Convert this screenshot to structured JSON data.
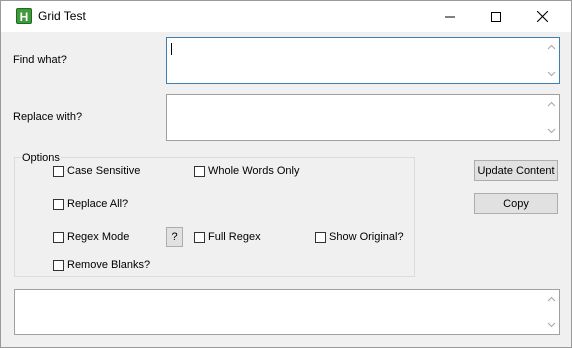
{
  "window": {
    "title": "Grid Test",
    "icon_letter": "H"
  },
  "titlebar_buttons": [
    "minimize-icon",
    "maximize-icon",
    "close-icon"
  ],
  "fields": {
    "find_label": "Find what?",
    "find_value": "",
    "replace_label": "Replace with?",
    "replace_value": "",
    "output_value": ""
  },
  "options": {
    "group_title": "Options",
    "case_sensitive": "Case Sensitive",
    "whole_words_only": "Whole Words Only",
    "replace_all": "Replace All?",
    "regex_mode": "Regex Mode",
    "regex_help": "?",
    "full_regex": "Full Regex",
    "show_original": "Show Original?",
    "remove_blanks": "Remove Blanks?"
  },
  "buttons": {
    "update_content": "Update Content",
    "copy": "Copy"
  },
  "colors": {
    "focus_border": "#3c7fb1",
    "app_icon": "#3f9a3a"
  }
}
